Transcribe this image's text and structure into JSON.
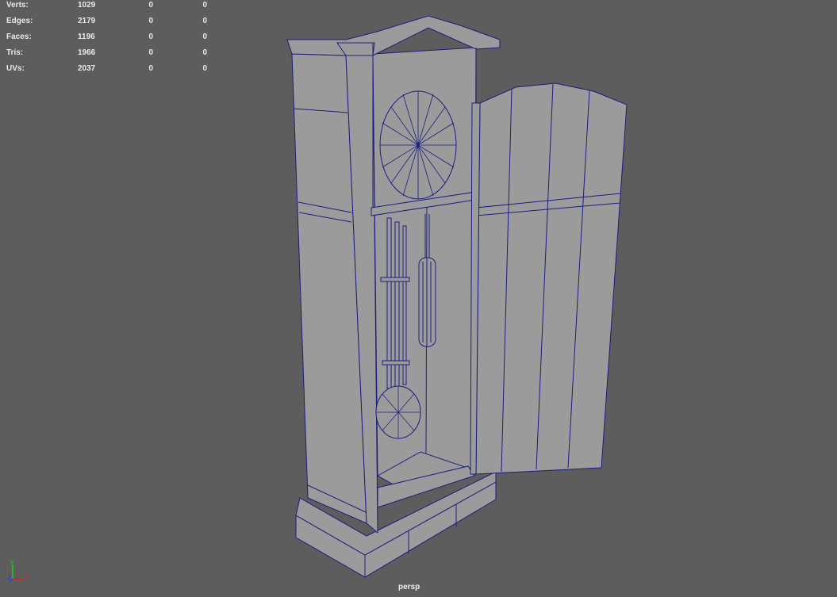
{
  "hud": {
    "rows": [
      {
        "label": "Verts:",
        "total": "1029",
        "selected": "0",
        "uv": "0"
      },
      {
        "label": "Edges:",
        "total": "2179",
        "selected": "0",
        "uv": "0"
      },
      {
        "label": "Faces:",
        "total": "1196",
        "selected": "0",
        "uv": "0"
      },
      {
        "label": "Tris:",
        "total": "1966",
        "selected": "0",
        "uv": "0"
      },
      {
        "label": "UVs:",
        "total": "2037",
        "selected": "0",
        "uv": "0"
      }
    ]
  },
  "camera": "persp",
  "axis": {
    "x": "x",
    "y": "y",
    "z": "z"
  },
  "colors": {
    "background": "#5d5d5d",
    "mesh": "#9b9b9b",
    "wireframe": "#1c1c80",
    "axis_x": "#e02020",
    "axis_y": "#20d020",
    "axis_z": "#2040ff"
  }
}
